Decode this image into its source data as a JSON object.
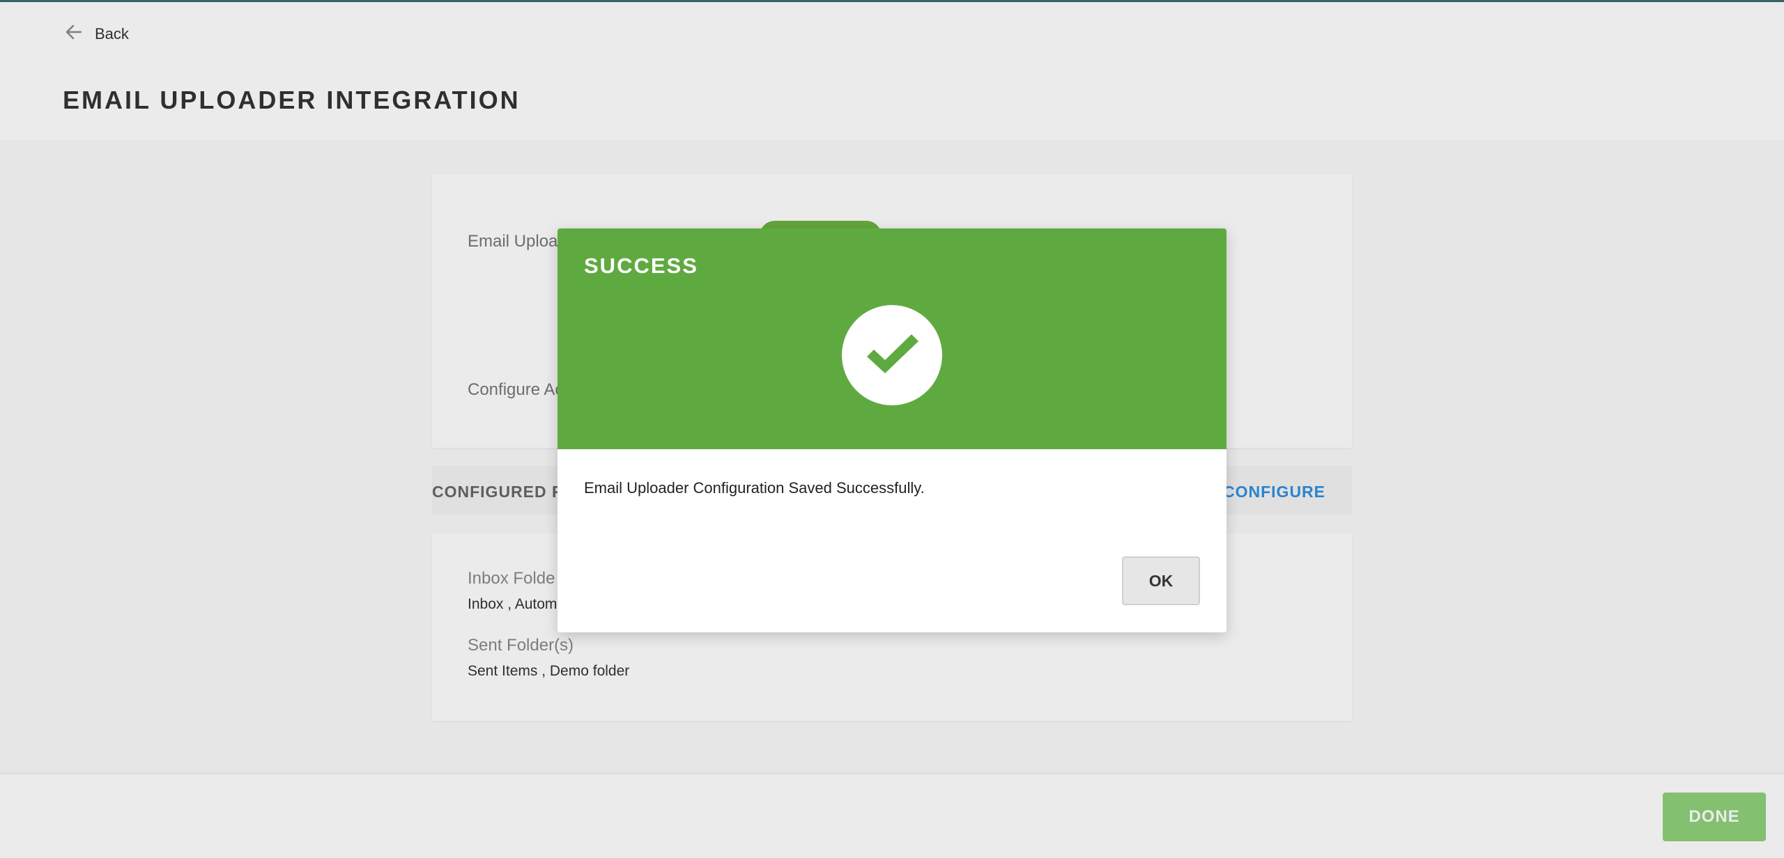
{
  "header": {
    "back_label": "Back",
    "back_icon": "arrow-left-icon"
  },
  "page": {
    "title": "EMAIL UPLOADER INTEGRATION"
  },
  "settings_card": {
    "email_uploader_label": "Email Uploa",
    "configure_label": "Configure Ac",
    "toggle_color": "#6cb33f"
  },
  "folders_section": {
    "title": "CONFIGURED F",
    "configure_link": "CONFIGURE",
    "inbox_label": "Inbox Folde",
    "inbox_value": "Inbox , Autom",
    "sent_label": "Sent Folder(s)",
    "sent_value": "Sent Items , Demo folder"
  },
  "footer": {
    "done_label": "DONE"
  },
  "modal": {
    "title": "SUCCESS",
    "icon": "check-circle-icon",
    "message": "Email Uploader Configuration Saved Successfully.",
    "ok_label": "OK",
    "header_color": "#5faa40"
  }
}
